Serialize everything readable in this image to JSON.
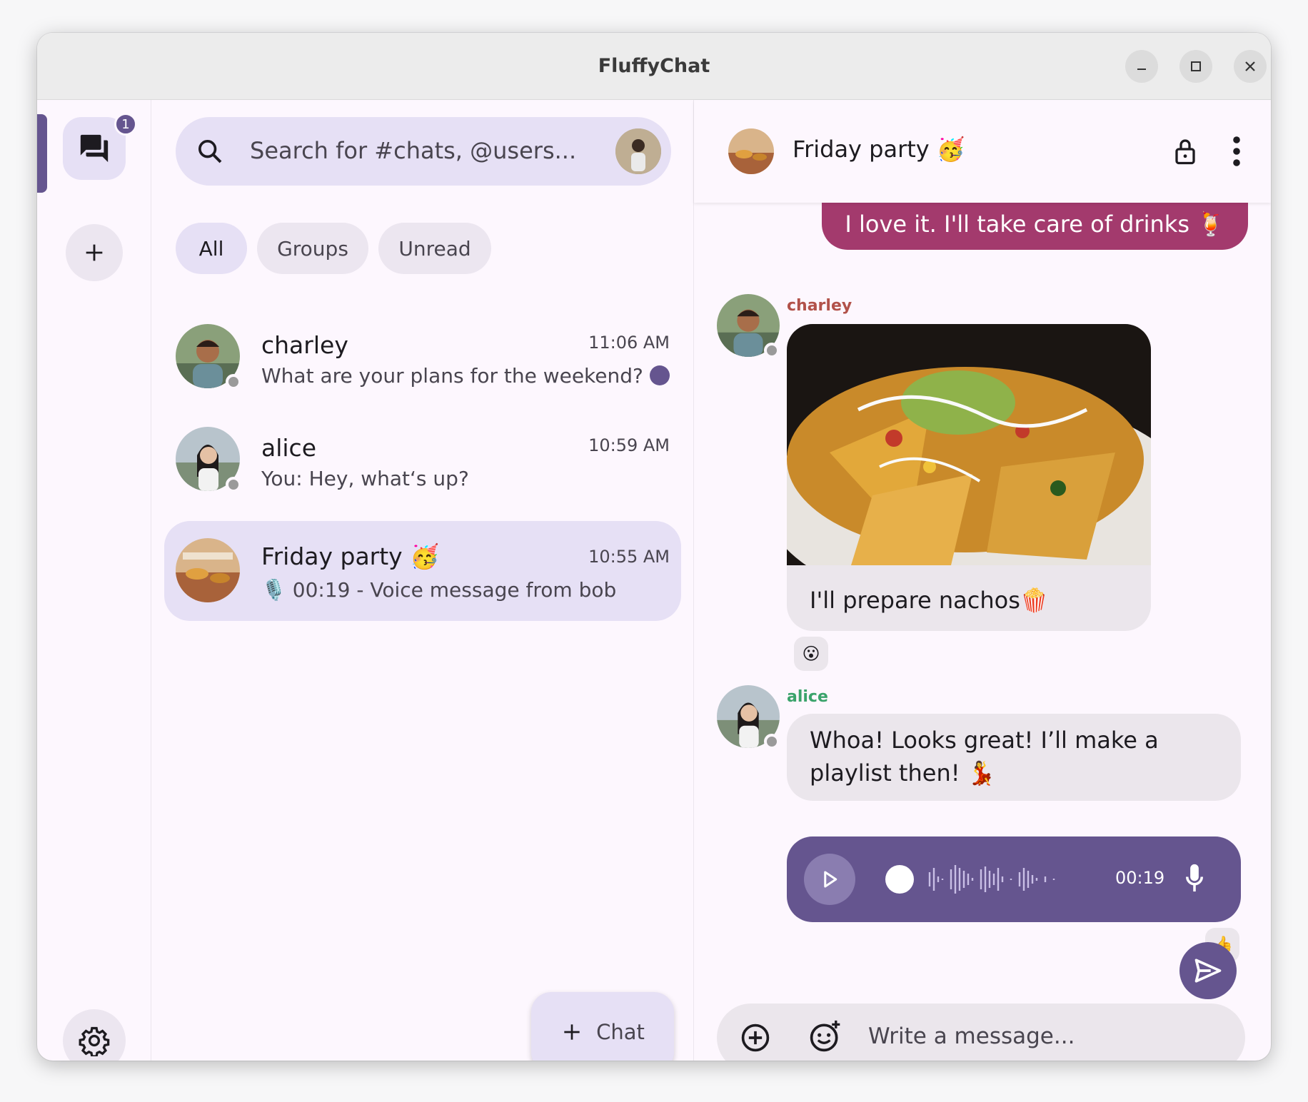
{
  "window": {
    "title": "FluffyChat"
  },
  "rail": {
    "badge_count": "1"
  },
  "search": {
    "placeholder": "Search for #chats, @users..."
  },
  "filters": [
    "All",
    "Groups",
    "Unread"
  ],
  "chats": [
    {
      "name": "charley",
      "time": "11:06 AM",
      "preview": "What are your plans for the weekend?",
      "unread": true
    },
    {
      "name": "alice",
      "time": "10:59 AM",
      "preview": "You: Hey, what‘s up?",
      "unread": false
    },
    {
      "name": "Friday party 🥳",
      "time": "10:55 AM",
      "preview": "🎙️ 00:19 - Voice message from bob",
      "unread": false
    }
  ],
  "fab": {
    "label": "Chat"
  },
  "room": {
    "title": "Friday party 🥳"
  },
  "messages": {
    "own_text": "I love it. I'll take care of drinks 🍹",
    "charley_sender": "charley",
    "charley_caption": "I'll prepare nachos🍿",
    "charley_reaction": "😮",
    "alice_sender": "alice",
    "alice_text": "Whoa! Looks great! I’ll make a playlist then! 💃",
    "voice_duration": "00:19",
    "voice_reaction": "👍"
  },
  "composer": {
    "placeholder": "Write a message..."
  },
  "colors": {
    "primary": "#65558f",
    "own_bubble": "#a33a6d",
    "charley_name": "#b2524a",
    "alice_name": "#3aa36b"
  }
}
